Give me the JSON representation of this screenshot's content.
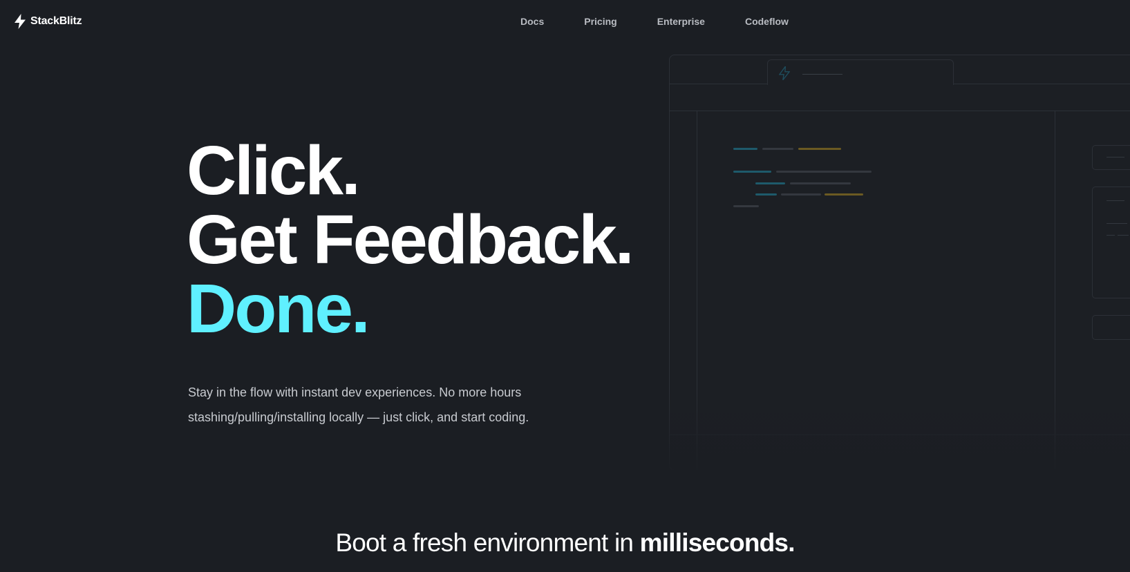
{
  "brand": {
    "name": "StackBlitz",
    "logo_icon": "bolt-icon"
  },
  "nav": {
    "links": [
      "Docs",
      "Pricing",
      "Enterprise",
      "Codeflow"
    ]
  },
  "hero": {
    "title_line1": "Click.",
    "title_line2": "Get Feedback.",
    "title_line3": "Done.",
    "subtitle": "Stay in the flow with instant dev experiences. No more hours stashing/pulling/installing locally — just click, and start coding."
  },
  "tagline": {
    "prefix": "Boot a fresh environment in ",
    "emphasis": "milliseconds."
  },
  "colors": {
    "background": "#1b1e23",
    "accent": "#5ff0ff",
    "text": "#ffffff",
    "muted": "#c8cbd0",
    "code_blue": "#1e5a6b",
    "code_gold": "#6b5a22"
  }
}
